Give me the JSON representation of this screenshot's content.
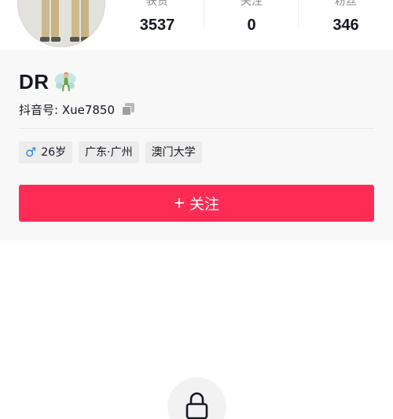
{
  "profile": {
    "name": "DR",
    "id_text": "抖音号: Xue7850",
    "stats": [
      {
        "label": "获赞",
        "value": "3537"
      },
      {
        "label": "关注",
        "value": "0"
      },
      {
        "label": "粉丝",
        "value": "346"
      }
    ],
    "tags": [
      {
        "icon": "male-icon",
        "icon_glyph": "♂",
        "text": "26岁"
      },
      {
        "text": "广东·广州"
      },
      {
        "text": "澳门大学"
      }
    ],
    "follow_button": {
      "plus": "+",
      "label": "关注"
    }
  },
  "colors": {
    "accent": "#fe2c55",
    "male": "#2b87d9",
    "card_bg": "#f8f8f8"
  },
  "icons": {
    "name_emoji": "fairy-icon",
    "copy": "copy-icon",
    "lock": "lock-icon"
  }
}
